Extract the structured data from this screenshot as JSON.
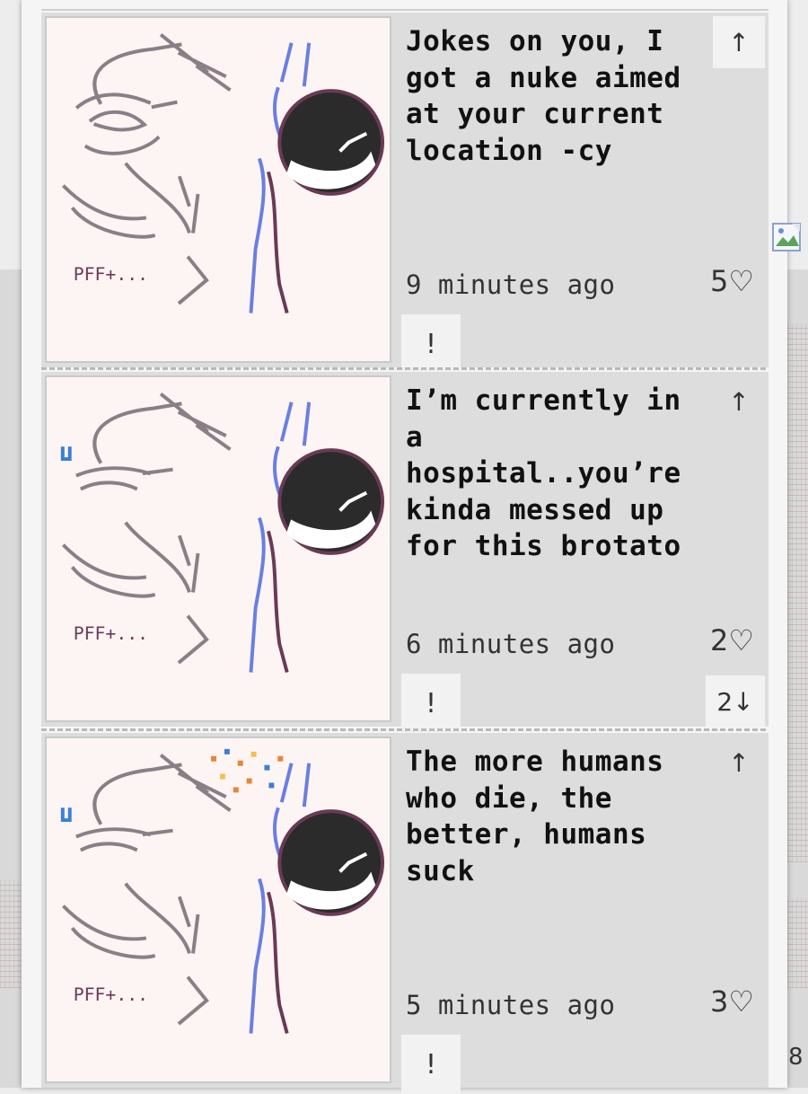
{
  "posts": [
    {
      "text": "Jokes on you, I got a nuke aimed at your current location -cy",
      "time": "9 minutes ago",
      "likes": "5♡",
      "upvote": "↑",
      "report": "!",
      "art_caption": "PFF+..."
    },
    {
      "text": "I’m currently in a hospital..you’re kinda messed up for this brotato",
      "time": "6 minutes ago",
      "likes": "2♡",
      "upvote": "↑",
      "report": "!",
      "reply_count": "2↓",
      "art_caption": "PFF+..."
    },
    {
      "text": "The more humans who die, the better, humans suck",
      "time": "5 minutes ago",
      "likes": "3♡",
      "upvote": "↑",
      "report": "!",
      "art_caption": "PFF+..."
    }
  ],
  "page_number": "8",
  "colors": {
    "post_bg": "#dddddd",
    "thumb_bg": "#fdf4f4",
    "line_gray": "#8a7f86",
    "line_purple": "#6a3a55",
    "line_blue": "#6a7fe0",
    "text": "#111111"
  }
}
